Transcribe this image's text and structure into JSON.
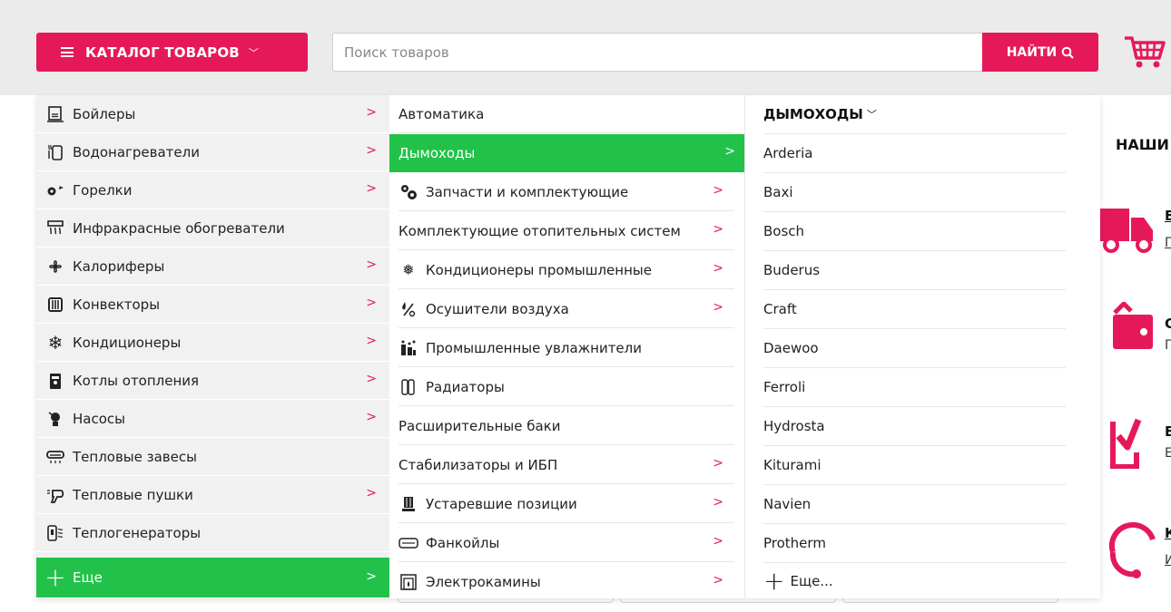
{
  "header": {
    "catalog_label": "КАТАЛОГ ТОВАРОВ",
    "search_placeholder": "Поиск товаров",
    "search_button": "НАЙТИ",
    "cart_icon": "cart-icon"
  },
  "colors": {
    "brand": "#e5195a",
    "active_green": "#22c24a",
    "header_bg": "#ebebeb"
  },
  "menu": {
    "categories": [
      {
        "label": "Бойлеры",
        "icon": "boiler-icon",
        "has_sub": true
      },
      {
        "label": "Водонагреватели",
        "icon": "water-heater-icon",
        "has_sub": true
      },
      {
        "label": "Горелки",
        "icon": "burner-icon",
        "has_sub": true
      },
      {
        "label": "Инфракрасные обогреватели",
        "icon": "infrared-heater-icon",
        "has_sub": false
      },
      {
        "label": "Калориферы",
        "icon": "fan-heater-icon",
        "has_sub": true
      },
      {
        "label": "Конвекторы",
        "icon": "convector-icon",
        "has_sub": true
      },
      {
        "label": "Кондиционеры",
        "icon": "snowflake-icon",
        "has_sub": true
      },
      {
        "label": "Котлы отопления",
        "icon": "heating-boiler-icon",
        "has_sub": true
      },
      {
        "label": "Насосы",
        "icon": "pump-icon",
        "has_sub": true
      },
      {
        "label": "Тепловые завесы",
        "icon": "air-curtain-icon",
        "has_sub": false
      },
      {
        "label": "Тепловые пушки",
        "icon": "heat-gun-icon",
        "has_sub": true
      },
      {
        "label": "Теплогенераторы",
        "icon": "heat-generator-icon",
        "has_sub": false
      },
      {
        "label": "Еще",
        "icon": "plus-icon",
        "has_sub": true,
        "active": true
      }
    ],
    "subcategories": [
      {
        "label": "Автоматика",
        "icon": "",
        "has_sub": false
      },
      {
        "label": "Дымоходы",
        "icon": "",
        "has_sub": true,
        "active": true
      },
      {
        "label": "Запчасти и комплектующие",
        "icon": "gears-icon",
        "has_sub": true
      },
      {
        "label": "Комплектующие отопительных систем",
        "icon": "",
        "has_sub": true
      },
      {
        "label": "Кондиционеры промышленные",
        "icon": "industrial-ac-icon",
        "has_sub": true
      },
      {
        "label": "Осушители воздуха",
        "icon": "dehumidifier-icon",
        "has_sub": true
      },
      {
        "label": "Промышленные увлажнители",
        "icon": "humidifier-icon",
        "has_sub": false
      },
      {
        "label": "Радиаторы",
        "icon": "radiator-icon",
        "has_sub": false
      },
      {
        "label": "Расширительные баки",
        "icon": "",
        "has_sub": false
      },
      {
        "label": "Стабилизаторы и ИБП",
        "icon": "",
        "has_sub": true
      },
      {
        "label": "Устаревшие позиции",
        "icon": "obsolete-icon",
        "has_sub": true
      },
      {
        "label": "Фанкойлы",
        "icon": "fancoil-icon",
        "has_sub": true
      },
      {
        "label": "Электрокамины",
        "icon": "fireplace-icon",
        "has_sub": true
      }
    ],
    "brands_title": "ДЫМОХОДЫ",
    "brands": [
      "Arderia",
      "Baxi",
      "Bosch",
      "Buderus",
      "Craft",
      "Daewoo",
      "Ferroli",
      "Hydrosta",
      "Kiturami",
      "Navien",
      "Protherm"
    ],
    "brands_more": "Еще..."
  },
  "right": {
    "heading": "НАШИ",
    "features": [
      {
        "icon": "truck-icon",
        "title": "Б",
        "sub": "Г"
      },
      {
        "icon": "wallet-icon",
        "title": "С",
        "sub": "Г"
      },
      {
        "icon": "checkbox-icon",
        "title": "Б",
        "sub": "Е"
      },
      {
        "icon": "headset-icon",
        "title": "К",
        "sub": "И"
      }
    ]
  }
}
